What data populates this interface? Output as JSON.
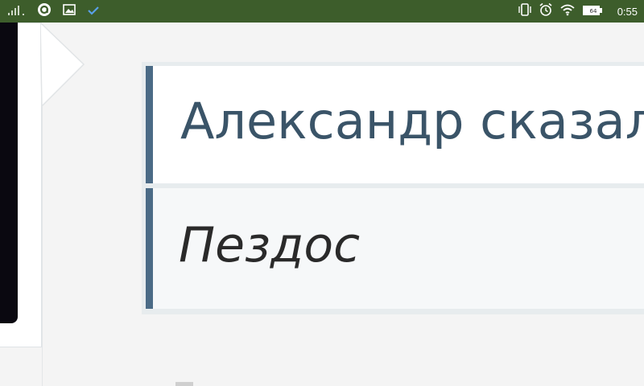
{
  "status_bar": {
    "time": "0:55",
    "battery_level": "64",
    "left_icons": [
      "signal-icon",
      "app-notification-icon",
      "image-notification-icon",
      "check-notification-icon"
    ],
    "right_icons": [
      "vibrate-icon",
      "alarm-icon",
      "wifi-icon",
      "battery-icon"
    ],
    "background_color": "#3d5d2b"
  },
  "quote": {
    "author_line": "Александр сказал",
    "text": "Пездос",
    "accent_color": "#4b6b86",
    "author_color": "#3a5468"
  }
}
